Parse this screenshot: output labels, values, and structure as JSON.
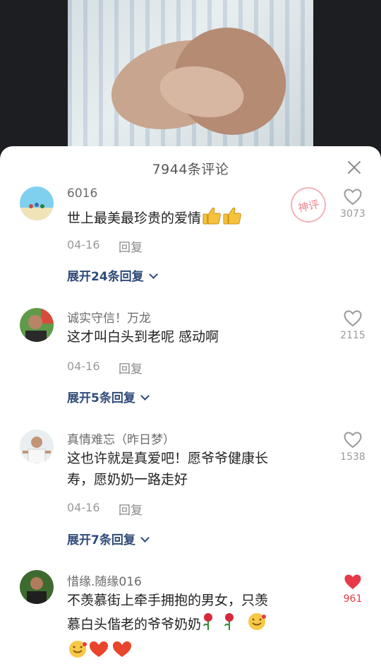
{
  "panel": {
    "title": "7944条评论"
  },
  "comments": [
    {
      "username": "6016",
      "text": "世上最美最珍贵的爱情",
      "date": "04-16",
      "reply_label": "回复",
      "expand_label": "展开24条回复",
      "likes": "3073",
      "liked": false,
      "badge": "神评"
    },
    {
      "username": "诚实守信！万龙",
      "text": "这才叫白头到老呢 感动啊",
      "date": "04-16",
      "reply_label": "回复",
      "expand_label": "展开5条回复",
      "likes": "2115",
      "liked": false
    },
    {
      "username": "真情难忘（昨日梦）",
      "text_line1": "这也许就是真爱吧！愿爷爷健康长",
      "text_line2": "寿，愿奶奶一路走好",
      "date": "04-16",
      "reply_label": "回复",
      "expand_label": "展开7条回复",
      "likes": "1538",
      "liked": false
    },
    {
      "username": "惜缘.随缘016",
      "text_line1": "不羡慕街上牵手拥抱的男女，只羡",
      "text_line2": "慕白头偕老的爷爷奶奶",
      "likes": "961",
      "liked": true
    }
  ],
  "colors": {
    "liked": "#e63a4a",
    "expand": "#2f4a78"
  }
}
